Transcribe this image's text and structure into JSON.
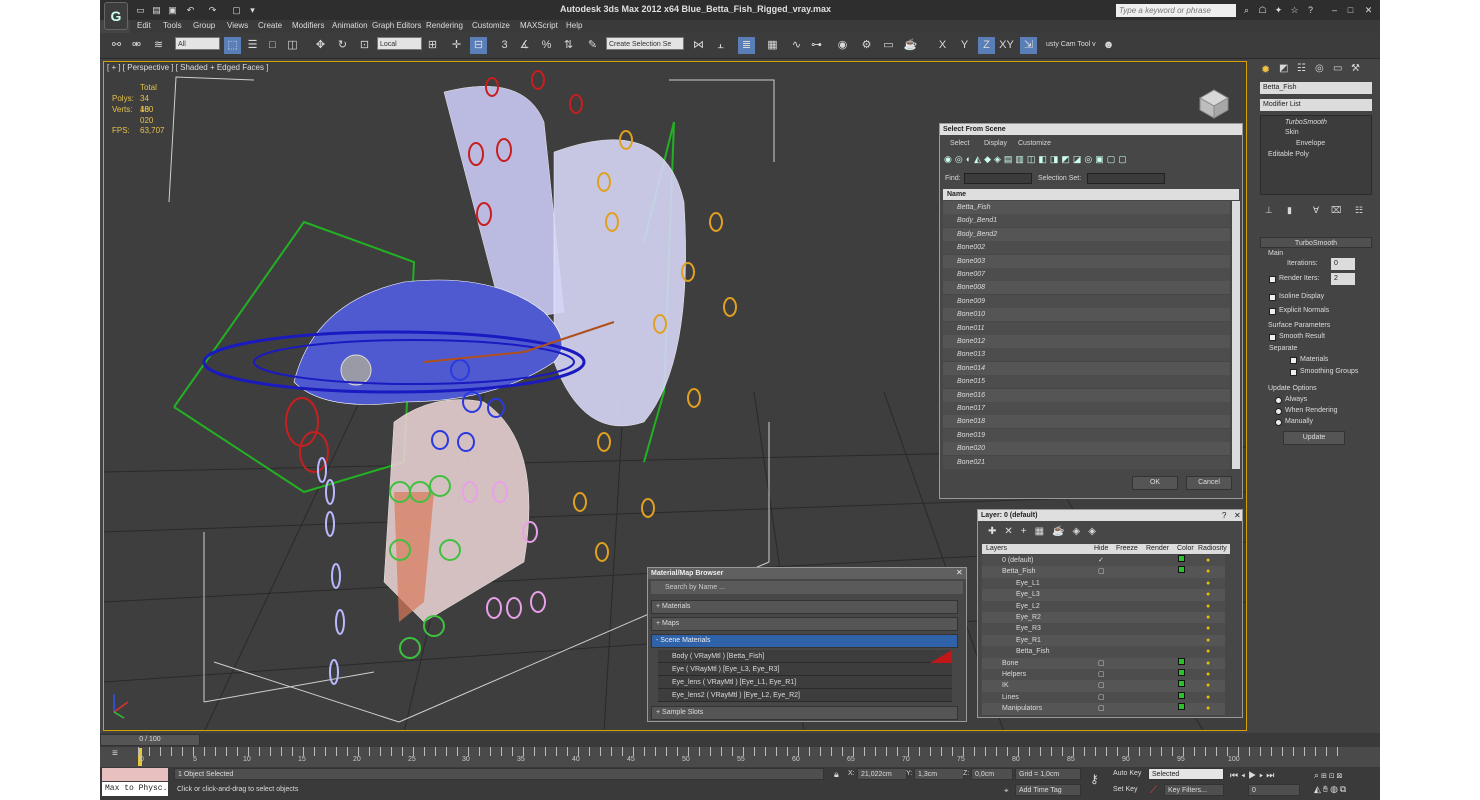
{
  "window": {
    "title": "Autodesk 3ds Max  2012 x64      Blue_Betta_Fish_Rigged_vray.max",
    "search_placeholder": "Type a keyword or phrase"
  },
  "menu": [
    "Edit",
    "Tools",
    "Group",
    "Views",
    "Create",
    "Modifiers",
    "Animation",
    "Graph Editors",
    "Rendering",
    "Customize",
    "MAXScript",
    "Help"
  ],
  "toolbar": {
    "filter": "All",
    "coord_system": "Local",
    "selection_set": "Create Selection Se",
    "constraints": [
      "X",
      "Y",
      "Z",
      "XY"
    ],
    "plugin_label": "usty Cam Tool v"
  },
  "viewport": {
    "label": "[ + ] [ Perspective ] [ Shaded + Edged Faces ]",
    "stats": {
      "header": "Total",
      "polys_label": "Polys:",
      "polys": "34 400",
      "verts_label": "Verts:",
      "verts": "18 020",
      "fps_label": "FPS:",
      "fps": "63,707"
    }
  },
  "command_panel": {
    "object_name": "Betta_Fish",
    "modifier_list": "Modifier List",
    "stack": [
      "TurboSmooth",
      "Skin",
      "Envelope",
      "Editable Poly"
    ],
    "turbosmooth": {
      "title": "TurboSmooth",
      "main": "Main",
      "iterations_label": "Iterations:",
      "iterations": "0",
      "render_iters_label": "Render Iters:",
      "render_iters": "2",
      "isoline": "Isoline Display",
      "explicit_normals": "Explicit Normals",
      "surface_params": "Surface Parameters",
      "smooth_result": "Smooth Result",
      "separate": "Separate",
      "materials": "Materials",
      "smoothing_groups": "Smoothing Groups",
      "update_options": "Update Options",
      "always": "Always",
      "when_rendering": "When Rendering",
      "manually": "Manually",
      "update_btn": "Update"
    }
  },
  "select_dialog": {
    "title": "Select From Scene",
    "menus": [
      "Select",
      "Display",
      "Customize"
    ],
    "find_label": "Find:",
    "selset_label": "Selection Set:",
    "column": "Name",
    "items": [
      "Betta_Fish",
      "Body_Bend1",
      "Body_Bend2",
      "Bone002",
      "Bone003",
      "Bone007",
      "Bone008",
      "Bone009",
      "Bone010",
      "Bone011",
      "Bone012",
      "Bone013",
      "Bone014",
      "Bone015",
      "Bone016",
      "Bone017",
      "Bone018",
      "Bone019",
      "Bone020",
      "Bone021"
    ],
    "ok": "OK",
    "cancel": "Cancel"
  },
  "layer_dialog": {
    "title": "Layer: 0 (default)",
    "columns": [
      "Layers",
      "Hide",
      "Freeze",
      "Render",
      "Color",
      "Radiosity"
    ],
    "rows": [
      "0 (default)",
      "Betta_Fish",
      "Eye_L1",
      "Eye_L3",
      "Eye_L2",
      "Eye_R2",
      "Eye_R3",
      "Eye_R1",
      "Betta_Fish",
      "Bone",
      "Helpers",
      "IK",
      "Lines",
      "Manipulators"
    ]
  },
  "material_browser": {
    "title": "Material/Map Browser",
    "search_placeholder": "Search by Name ...",
    "groups": [
      "+ Materials",
      "+ Maps",
      "- Scene Materials",
      "+ Sample Slots"
    ],
    "scene_materials": [
      "Body  ( VRayMtl )  [Betta_Fish]",
      "Eye  ( VRayMtl )  [Eye_L3, Eye_R3]",
      "Eye_lens  ( VRayMtl )  [Eye_L1, Eye_R1]",
      "Eye_lens2  ( VRayMtl )  [Eye_L2, Eye_R2]"
    ]
  },
  "timeline": {
    "frame": "0 / 100",
    "ticks": [
      "0",
      "5",
      "10",
      "15",
      "20",
      "25",
      "30",
      "35",
      "40",
      "45",
      "50",
      "55",
      "60",
      "65",
      "70",
      "75",
      "80",
      "85",
      "90",
      "95",
      "100"
    ]
  },
  "status": {
    "script_box": "Max to Physc.",
    "selected": "1 Object Selected",
    "prompt": "Click or click-and-drag to select objects",
    "x_label": "X:",
    "x": "21,022cm",
    "y_label": "Y:",
    "y": "1,3cm",
    "z_label": "Z:",
    "z": "0,0cm",
    "grid": "Grid = 1,0cm",
    "add_time_tag": "Add Time Tag",
    "auto_key": "Auto Key",
    "set_key": "Set Key",
    "selected_mode": "Selected",
    "key_filters": "Key Filters...",
    "current_frame": "0"
  }
}
